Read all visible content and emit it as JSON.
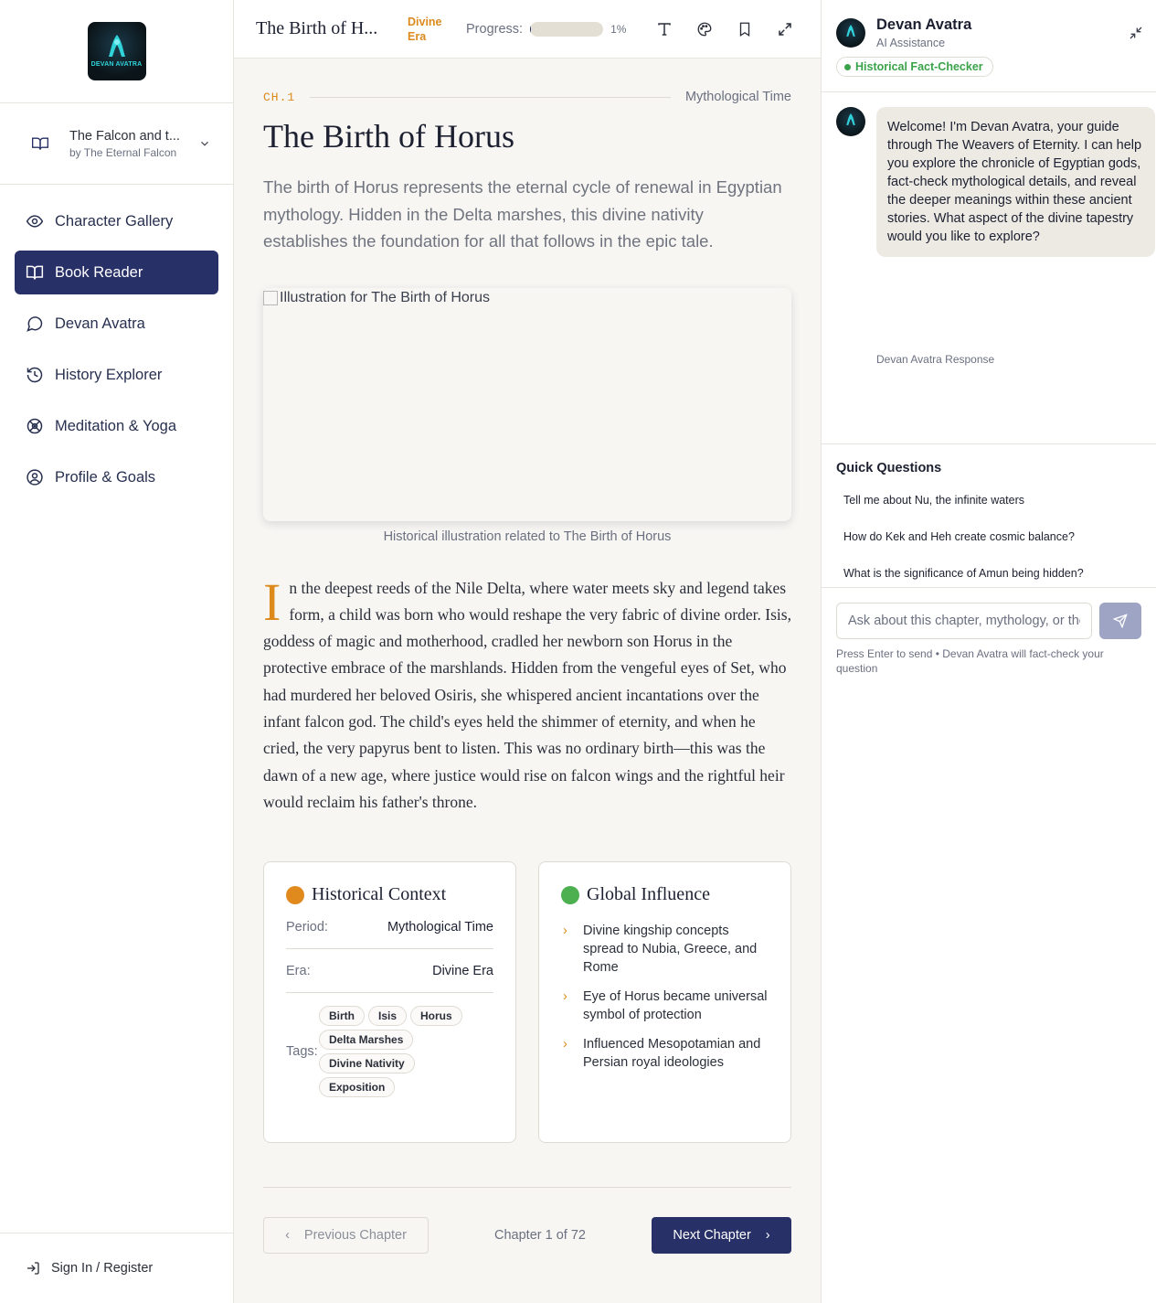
{
  "sidebar": {
    "logo_text": "DEVAN AVATRA",
    "book": {
      "title": "The Falcon and t...",
      "author": "by The Eternal Falcon"
    },
    "nav": [
      {
        "label": "Character Gallery",
        "icon": "eye-icon"
      },
      {
        "label": "Book Reader",
        "icon": "book-open-icon",
        "active": true
      },
      {
        "label": "Devan Avatra",
        "icon": "message-circle-icon"
      },
      {
        "label": "History Explorer",
        "icon": "history-icon"
      },
      {
        "label": "Meditation & Yoga",
        "icon": "meditation-icon"
      },
      {
        "label": "Profile & Goals",
        "icon": "user-circle-icon"
      }
    ],
    "signin": "Sign In / Register"
  },
  "topbar": {
    "title": "The Birth of H...",
    "era": "Divine Era",
    "progress_label": "Progress:",
    "progress_fraction": 0.01,
    "progress_text": "1%",
    "tools": [
      "type-icon",
      "palette-icon",
      "bookmark-icon",
      "maximize-icon"
    ]
  },
  "chapter": {
    "number": "CH.1",
    "period": "Mythological Time",
    "title": "The Birth of Horus",
    "summary": "The birth of Horus represents the eternal cycle of renewal in Egyptian mythology. Hidden in the Delta marshes, this divine nativity establishes the foundation for all that follows in the epic tale.",
    "image_alt": "Illustration for The Birth of Horus",
    "caption": "Historical illustration related to The Birth of Horus",
    "dropcap": "I",
    "body": "n the deepest reeds of the Nile Delta, where water meets sky and legend takes form, a child was born who would reshape the very fabric of divine order. Isis, goddess of magic and motherhood, cradled her newborn son Horus in the protective embrace of the marshlands. Hidden from the vengeful eyes of Set, who had murdered her beloved Osiris, she whispered ancient incantations over the infant falcon god. The child's eyes held the shimmer of eternity, and when he cried, the very papyrus bent to listen. This was no ordinary birth—this was the dawn of a new age, where justice would rise on falcon wings and the rightful heir would reclaim his father's throne."
  },
  "context": {
    "title": "Historical Context",
    "color": "#e08a1e",
    "period_label": "Period:",
    "period_value": "Mythological Time",
    "era_label": "Era:",
    "era_value": "Divine Era",
    "tags_label": "Tags:",
    "tags": [
      "Birth",
      "Isis",
      "Horus",
      "Delta Marshes",
      "Divine Nativity",
      "Exposition"
    ]
  },
  "influence": {
    "title": "Global Influence",
    "color": "#4caf50",
    "items": [
      "Divine kingship concepts spread to Nubia, Greece, and Rome",
      "Eye of Horus became universal symbol of protection",
      "Influenced Mesopotamian and Persian royal ideologies"
    ]
  },
  "pager": {
    "prev": "Previous Chapter",
    "count": "Chapter 1 of 72",
    "next": "Next Chapter"
  },
  "panel": {
    "name": "Devan Avatra",
    "subtitle": "AI Assistance",
    "badge": "Historical Fact-Checker",
    "message": "Welcome! I'm Devan Avatra, your guide through The Weavers of Eternity. I can help you explore the chronicle of Egyptian gods, fact-check mythological details, and reveal the deeper meanings within these ancient stories. What aspect of the divine tapestry would you like to explore?",
    "message_meta": "Devan Avatra Response",
    "quick_title": "Quick Questions",
    "quick": [
      "Tell me about Nu, the infinite waters",
      "How do Kek and Heh create cosmic balance?",
      "What is the significance of Amun being hidden?"
    ],
    "input_placeholder": "Ask about this chapter, mythology, or the",
    "hint": "Press Enter to send • Devan Avatra will fact-check your question"
  }
}
